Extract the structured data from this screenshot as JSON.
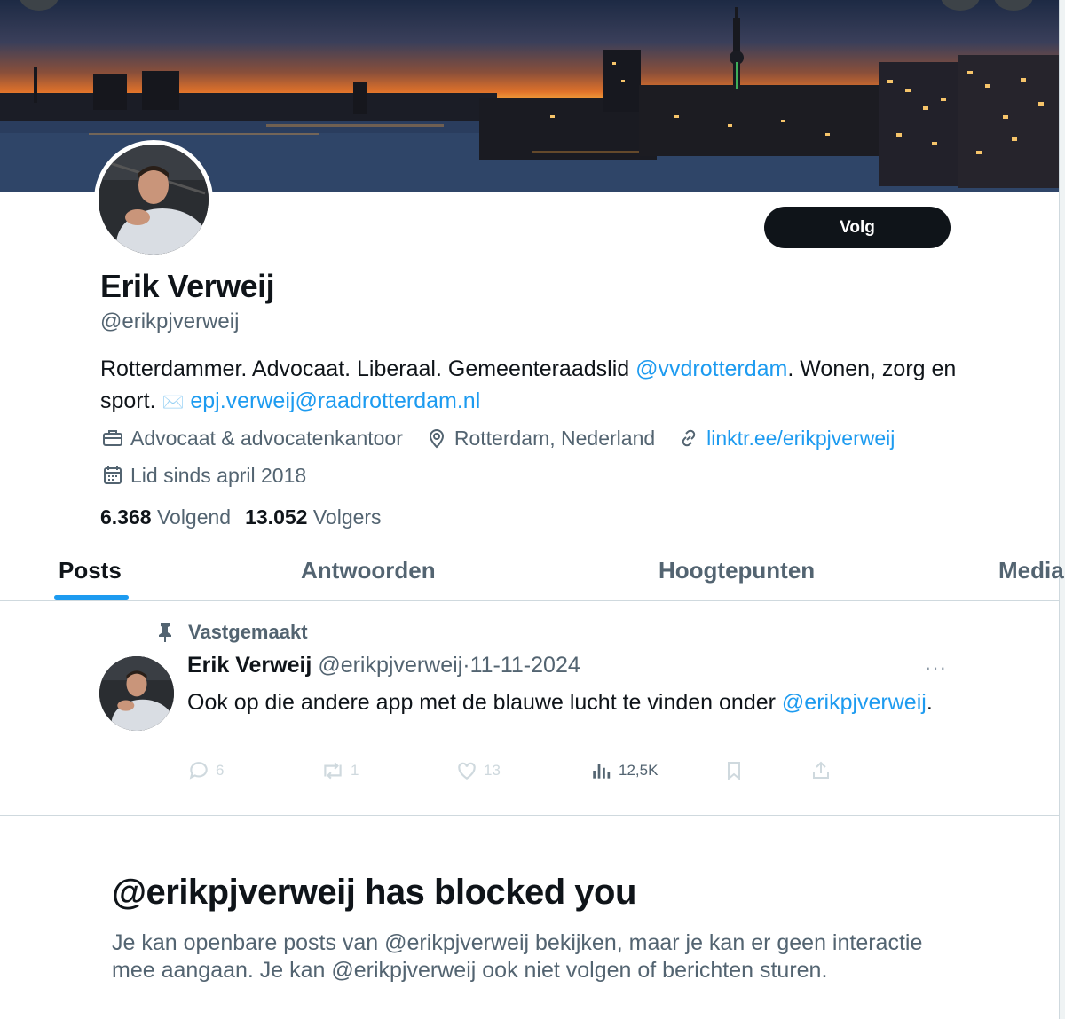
{
  "profile": {
    "name": "Erik Verweij",
    "handle": "@erikpjverweij",
    "follow_label": "Volg",
    "bio_part1": "Rotterdammer. Advocaat. Liberaal. Gemeenteraadslid ",
    "bio_mention": "@vvdrotterdam",
    "bio_part2": ". Wonen, zorg en sport. ",
    "bio_email_icon": "✉️",
    "bio_email": "epj.verweij@raadrotterdam.nl",
    "category": "Advocaat & advocatenkantoor",
    "location": "Rotterdam, Nederland",
    "website": "linktr.ee/erikpjverweij",
    "joined": "Lid sinds april 2018",
    "following_count": "6.368",
    "following_label": "Volgend",
    "followers_count": "13.052",
    "followers_label": "Volgers"
  },
  "icons": {
    "category": "briefcase-icon",
    "location": "location-pin-icon",
    "website": "link-icon",
    "joined": "calendar-icon",
    "pinned": "pin-icon",
    "more": "more-icon",
    "reply": "reply-icon",
    "repost": "repost-icon",
    "like": "like-icon",
    "views": "views-icon",
    "bookmark": "bookmark-icon",
    "share": "share-icon"
  },
  "tabs": [
    {
      "label": "Posts",
      "active": true
    },
    {
      "label": "Antwoorden",
      "active": false
    },
    {
      "label": "Hoogtepunten",
      "active": false
    },
    {
      "label": "Media",
      "active": false
    }
  ],
  "pinned_post": {
    "pinned_label": "Vastgemaakt",
    "author": "Erik Verweij",
    "handle": "@erikpjverweij",
    "separator": "·",
    "date": "11-11-2024",
    "more": "···",
    "text": "Ook op die andere app met de blauwe lucht te vinden onder ",
    "mention": "@erikpjverweij",
    "text_end": ".",
    "replies": "6",
    "reposts": "1",
    "likes": "13",
    "views": "12,5K"
  },
  "blocked": {
    "title": "@erikpjverweij has blocked you",
    "text": "Je kan openbare posts van @erikpjverweij bekijken, maar je kan er geen interactie mee aangaan. Je kan @erikpjverweij ook niet volgen of berichten sturen."
  },
  "colors": {
    "accent": "#1d9bf0",
    "text_primary": "#0f1419",
    "text_secondary": "#536471",
    "follow_button": "#0f1419"
  }
}
